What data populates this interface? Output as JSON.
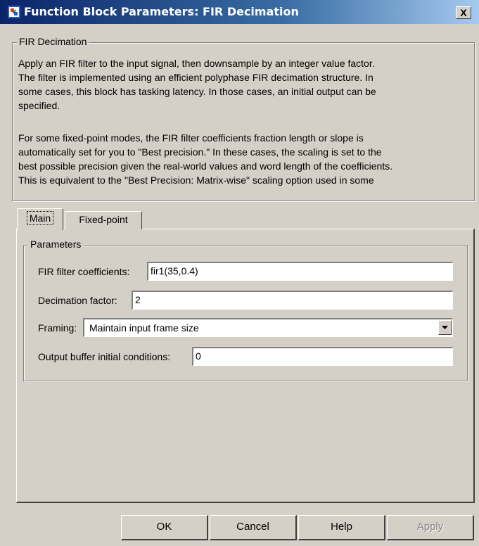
{
  "window": {
    "title": "Function Block Parameters: FIR Decimation",
    "close_label": "X",
    "icon": "simulink-block-icon"
  },
  "description": {
    "group_title": "FIR Decimation",
    "lines": [
      "Apply an FIR filter to the input signal, then downsample by an integer value factor.",
      "The filter is implemented using an efficient polyphase FIR decimation structure.  In",
      "some cases, this block has tasking latency.  In those cases, an initial output can be",
      "specified.",
      "",
      "For some fixed-point modes, the FIR filter coefficients fraction length or slope is",
      "automatically set for you to \"Best precision.\" In these cases, the scaling is set to the",
      "best possible precision given the real-world values and word length of the coefficients.",
      "This is equivalent to the \"Best Precision: Matrix-wise\" scaling option used in some"
    ]
  },
  "tabs": [
    {
      "label": "Main",
      "selected": true
    },
    {
      "label": "Fixed-point",
      "selected": false
    }
  ],
  "parameters": {
    "group_title": "Parameters",
    "fir_coefficients": {
      "label": "FIR filter coefficients:",
      "value": "fir1(35,0.4)"
    },
    "decimation_factor": {
      "label": "Decimation factor:",
      "value": "2"
    },
    "framing": {
      "label": "Framing:",
      "value": "Maintain input frame size"
    },
    "output_buffer": {
      "label": "Output buffer initial conditions:",
      "value": "0"
    }
  },
  "buttons": {
    "ok": "OK",
    "cancel": "Cancel",
    "help": "Help",
    "apply": "Apply"
  },
  "colors": {
    "face": "#d4d0c8",
    "title_start": "#0a246a",
    "title_end": "#a6caf0"
  }
}
